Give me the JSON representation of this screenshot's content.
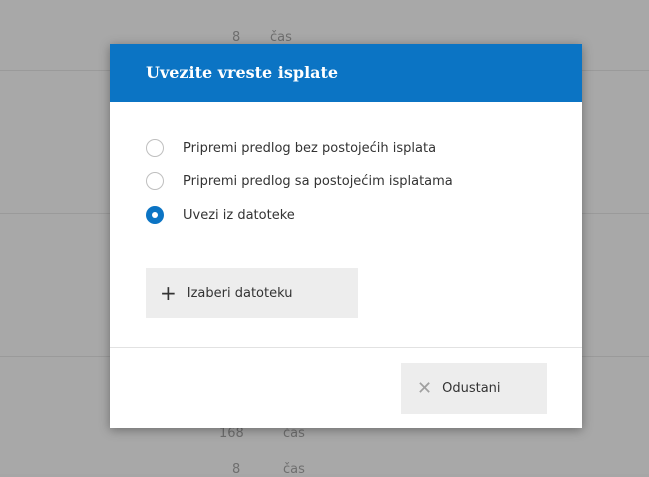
{
  "background": {
    "row1": {
      "value": "8",
      "unit": "čas"
    },
    "row2": {
      "value": "168",
      "unit": "čas"
    },
    "row3": {
      "value": "8",
      "unit": "čas"
    }
  },
  "dialog": {
    "title": "Uvezite vreste isplate",
    "header_color": "#0b74c4",
    "options": [
      {
        "label": "Pripremi predlog bez postojećih isplata",
        "checked": false
      },
      {
        "label": "Pripremi predlog sa postojećim isplatama",
        "checked": false
      },
      {
        "label": "Uvezi iz datoteke",
        "checked": true
      }
    ],
    "choose_file": {
      "icon": "plus-icon",
      "label": "Izaberi datoteku"
    },
    "cancel": {
      "icon": "close-icon",
      "label": "Odustani"
    }
  }
}
